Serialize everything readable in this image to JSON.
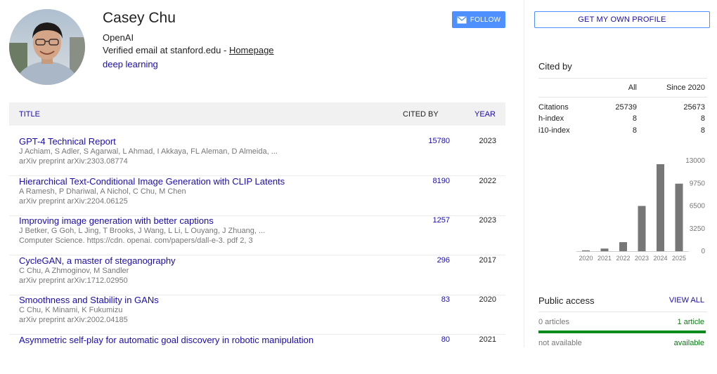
{
  "profile": {
    "name": "Casey Chu",
    "affiliation": "OpenAI",
    "verified": "Verified email at stanford.edu - ",
    "homepage": "Homepage",
    "interest": "deep learning",
    "follow_label": "FOLLOW",
    "get_profile_label": "GET MY OWN PROFILE"
  },
  "table": {
    "col_title": "TITLE",
    "col_cited": "CITED BY",
    "col_year": "YEAR",
    "rows": [
      {
        "title": "GPT-4 Technical Report",
        "authors": "J Achiam, S Adler, S Agarwal, L Ahmad, I Akkaya, FL Aleman, D Almeida, ...",
        "venue": "arXiv preprint arXiv:2303.08774",
        "cited": "15780",
        "year": "2023"
      },
      {
        "title": "Hierarchical Text-Conditional Image Generation with CLIP Latents",
        "authors": "A Ramesh, P Dhariwal, A Nichol, C Chu, M Chen",
        "venue": "arXiv preprint arXiv:2204.06125",
        "cited": "8190",
        "year": "2022"
      },
      {
        "title": "Improving image generation with better captions",
        "authors": "J Betker, G Goh, L Jing, T Brooks, J Wang, L Li, L Ouyang, J Zhuang, ...",
        "venue": "Computer Science. https://cdn. openai. com/papers/dall-e-3. pdf 2, 3",
        "cited": "1257",
        "year": "2023"
      },
      {
        "title": "CycleGAN, a master of steganography",
        "authors": "C Chu, A Zhmoginov, M Sandler",
        "venue": "arXiv preprint arXiv:1712.02950",
        "cited": "296",
        "year": "2017"
      },
      {
        "title": "Smoothness and Stability in GANs",
        "authors": "C Chu, K Minami, K Fukumizu",
        "venue": "arXiv preprint arXiv:2002.04185",
        "cited": "83",
        "year": "2020"
      },
      {
        "title": "Asymmetric self-play for automatic goal discovery in robotic manipulation",
        "authors": "",
        "venue": "",
        "cited": "80",
        "year": "2021"
      }
    ]
  },
  "cited_by": {
    "title": "Cited by",
    "col_all": "All",
    "col_since": "Since 2020",
    "stats": [
      {
        "label": "Citations",
        "all": "25739",
        "since": "25673"
      },
      {
        "label": "h-index",
        "all": "8",
        "since": "8"
      },
      {
        "label": "i10-index",
        "all": "8",
        "since": "8"
      }
    ]
  },
  "chart_data": {
    "type": "bar",
    "categories": [
      "2020",
      "2021",
      "2022",
      "2023",
      "2024",
      "2025"
    ],
    "values": [
      120,
      380,
      1300,
      6500,
      12500,
      9700
    ],
    "yticks": [
      "13000",
      "9750",
      "6500",
      "3250",
      "0"
    ],
    "ylim": [
      0,
      13000
    ],
    "bar_color": "#777777"
  },
  "public_access": {
    "title": "Public access",
    "view_all": "VIEW ALL",
    "left_count": "0 articles",
    "right_count": "1 article",
    "left_status": "not available",
    "right_status": "available",
    "available_fraction": 1.0
  },
  "colors": {
    "link": "#1a0dab",
    "follow_bg": "#4d90fe",
    "available": "#0b8a1d"
  }
}
